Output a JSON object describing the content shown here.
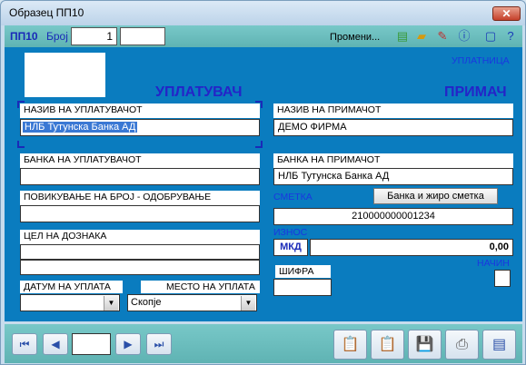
{
  "window": {
    "title": "Образец ПП10",
    "close_label": "✕"
  },
  "toolbar": {
    "form_code": "ПП10",
    "number_label": "Број",
    "number_value": "1",
    "second_field_value": "",
    "status_text": "Промени..."
  },
  "form": {
    "corner_label": "УПЛАТНИЦА",
    "payer_title": "УПЛАТУВАЧ",
    "recipient_title": "ПРИМАЧ",
    "payer_name_label": "НАЗИВ НА УПЛАТУВАЧОТ",
    "payer_name_value": "НЛБ Тутунска Банка АД",
    "payer_bank_label": "БАНКА НА УПЛАТУВАЧОТ",
    "payer_bank_value": "",
    "reference_label": "ПОВИКУВАЊЕ НА БРОЈ - ОДОБРУВАЊЕ",
    "reference_value": "",
    "purpose_label": "ЦЕЛ НА ДОЗНАКА",
    "purpose_line1": "",
    "purpose_line2": "",
    "payment_date_label": "ДАТУМ НА УПЛАТА",
    "payment_date_value": "",
    "payment_place_label": "МЕСТО НА УПЛАТА",
    "payment_place_value": "Скопје",
    "recipient_name_label": "НАЗИВ НА ПРИМАЧОТ",
    "recipient_name_value": "ДЕМО ФИРМА",
    "recipient_bank_label": "БАНКА НА ПРИМАЧОТ",
    "recipient_bank_value": "НЛБ Тутунска Банка АД",
    "account_label": "СМЕТКА",
    "bank_account_button": "Банка и жиро сметка",
    "account_value": "210000000001234",
    "amount_label": "ИЗНОС",
    "currency": "МКД",
    "amount_value": "0,00",
    "method_label": "НАЧИН",
    "code_label": "ШИФРА",
    "code_value": ""
  },
  "navigation": {
    "record_value": ""
  },
  "icons": {
    "first": "first-record-icon",
    "prev": "previous-record-icon",
    "next": "next-record-icon",
    "last": "last-record-icon",
    "add": "add-document-icon",
    "remove": "remove-document-icon",
    "save": "save-icon",
    "print": "print-icon",
    "preview": "page-icon"
  }
}
